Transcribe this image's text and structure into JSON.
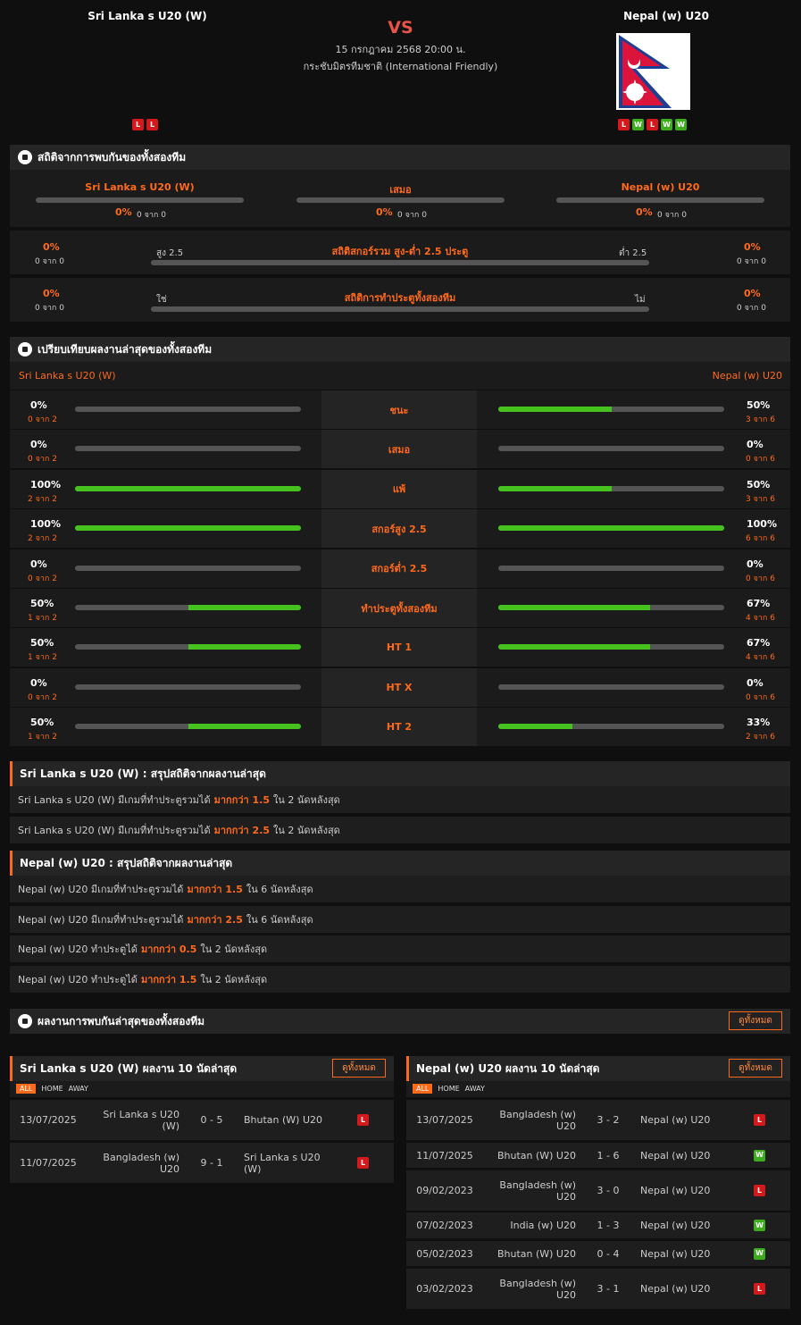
{
  "header": {
    "home_team": "Sri Lanka s U20 (W)",
    "away_team": "Nepal (w) U20",
    "vs": "VS",
    "date": "15 กรกฎาคม 2568 20:00 น.",
    "competition": "กระชับมิตรทีมชาติ (International Friendly)",
    "home_form": [
      "L",
      "L"
    ],
    "away_form": [
      "L",
      "W",
      "L",
      "W",
      "W"
    ],
    "colors": {
      "accent": "#ff6a1a",
      "win": "#3dac1f",
      "loss": "#d4181c",
      "bar_green": "#46c21e",
      "vs": "#e8544a"
    }
  },
  "h2h": {
    "title": "สถิติจากการพบกันของทั้งสองทีม",
    "cols": [
      {
        "label": "Sri Lanka s U20 (W)",
        "pct": "0%",
        "sub": "0 จาก 0"
      },
      {
        "label": "เสมอ",
        "pct": "0%",
        "sub": "0 จาก 0"
      },
      {
        "label": "Nepal (w) U20",
        "pct": "0%",
        "sub": "0 จาก 0"
      }
    ],
    "ou": {
      "title": "สถิติสกอร์รวม สูง-ต่ำ 2.5 ประตู",
      "left_label": "สูง 2.5",
      "right_label": "ต่ำ 2.5",
      "left_pct": "0%",
      "left_sub": "0 จาก 0",
      "right_pct": "0%",
      "right_sub": "0 จาก 0"
    },
    "btts": {
      "title": "สถิติการทำประตูทั้งสองทีม",
      "left_label": "ใช่",
      "right_label": "ไม่",
      "left_pct": "0%",
      "left_sub": "0 จาก 0",
      "right_pct": "0%",
      "right_sub": "0 จาก 0"
    }
  },
  "compare": {
    "title": "เปรียบเทียบผลงานล่าสุดของทั้งสองทีม",
    "home": "Sri Lanka s U20 (W)",
    "away": "Nepal (w) U20",
    "rows": [
      {
        "label": "ชนะ",
        "l_pct": "0%",
        "l_sub": "0 จาก 2",
        "l_val": 0,
        "r_pct": "50%",
        "r_sub": "3 จาก 6",
        "r_val": 0.5
      },
      {
        "label": "เสมอ",
        "l_pct": "0%",
        "l_sub": "0 จาก 2",
        "l_val": 0,
        "r_pct": "0%",
        "r_sub": "0 จาก 6",
        "r_val": 0
      },
      {
        "label": "แพ้",
        "l_pct": "100%",
        "l_sub": "2 จาก 2",
        "l_val": 1,
        "r_pct": "50%",
        "r_sub": "3 จาก 6",
        "r_val": 0.5
      },
      {
        "label": "สกอร์สูง 2.5",
        "l_pct": "100%",
        "l_sub": "2 จาก 2",
        "l_val": 1,
        "r_pct": "100%",
        "r_sub": "6 จาก 6",
        "r_val": 1
      },
      {
        "label": "สกอร์ต่ำ 2.5",
        "l_pct": "0%",
        "l_sub": "0 จาก 2",
        "l_val": 0,
        "r_pct": "0%",
        "r_sub": "0 จาก 6",
        "r_val": 0
      },
      {
        "label": "ทำประตูทั้งสองทีม",
        "l_pct": "50%",
        "l_sub": "1 จาก 2",
        "l_val": 0.5,
        "r_pct": "67%",
        "r_sub": "4 จาก 6",
        "r_val": 0.67
      },
      {
        "label": "HT 1",
        "l_pct": "50%",
        "l_sub": "1 จาก 2",
        "l_val": 0.5,
        "r_pct": "67%",
        "r_sub": "4 จาก 6",
        "r_val": 0.67
      },
      {
        "label": "HT X",
        "l_pct": "0%",
        "l_sub": "0 จาก 2",
        "l_val": 0,
        "r_pct": "0%",
        "r_sub": "0 จาก 6",
        "r_val": 0
      },
      {
        "label": "HT 2",
        "l_pct": "50%",
        "l_sub": "1 จาก 2",
        "l_val": 0.5,
        "r_pct": "33%",
        "r_sub": "2 จาก 6",
        "r_val": 0.33
      }
    ]
  },
  "summary_home": {
    "title": "Sri Lanka s U20 (W) : สรุปสถิติจากผลงานล่าสุด",
    "rows": [
      {
        "pre": "Sri Lanka s U20 (W)  มีเกมที่ทำประตูรวมได้",
        "hl": "มากกว่า  1.5",
        "post": "ใน 2 นัดหลังสุด"
      },
      {
        "pre": "Sri Lanka s U20 (W)  มีเกมที่ทำประตูรวมได้",
        "hl": "มากกว่า  2.5",
        "post": "ใน 2 นัดหลังสุด"
      }
    ]
  },
  "summary_away": {
    "title": "Nepal (w) U20 : สรุปสถิติจากผลงานล่าสุด",
    "rows": [
      {
        "pre": "Nepal (w) U20  มีเกมที่ทำประตูรวมได้",
        "hl": "มากกว่า  1.5",
        "post": "ใน 6 นัดหลังสุด"
      },
      {
        "pre": "Nepal (w) U20  มีเกมที่ทำประตูรวมได้",
        "hl": "มากกว่า  2.5",
        "post": "ใน 6 นัดหลังสุด"
      },
      {
        "pre": "Nepal (w) U20  ทำประตูได้",
        "hl": "มากกว่า  0.5",
        "post": "ใน 2 นัดหลังสุด"
      },
      {
        "pre": "Nepal (w) U20  ทำประตูได้",
        "hl": "มากกว่า  1.5",
        "post": "ใน 2 นัดหลังสุด"
      }
    ]
  },
  "recent": {
    "title": "ผลงานการพบกันล่าสุดของทั้งสองทีม",
    "view_all": "ดูทั้งหมด",
    "filters": [
      "ALL",
      "HOME",
      "AWAY"
    ],
    "home": {
      "title": "Sri Lanka s U20 (W) ผลงาน 10 นัดล่าสุด",
      "matches": [
        {
          "date": "13/07/2025",
          "home": "Sri Lanka s U20 (W)",
          "score": "0 - 5",
          "away": "Bhutan (W) U20",
          "res": "L"
        },
        {
          "date": "11/07/2025",
          "home": "Bangladesh (w) U20",
          "score": "9 - 1",
          "away": "Sri Lanka s U20 (W)",
          "res": "L"
        }
      ]
    },
    "away": {
      "title": "Nepal (w) U20 ผลงาน 10 นัดล่าสุด",
      "matches": [
        {
          "date": "13/07/2025",
          "home": "Bangladesh (w) U20",
          "score": "3 - 2",
          "away": "Nepal (w) U20",
          "res": "L"
        },
        {
          "date": "11/07/2025",
          "home": "Bhutan (W) U20",
          "score": "1 - 6",
          "away": "Nepal (w) U20",
          "res": "W"
        },
        {
          "date": "09/02/2023",
          "home": "Bangladesh (w) U20",
          "score": "3 - 0",
          "away": "Nepal (w) U20",
          "res": "L"
        },
        {
          "date": "07/02/2023",
          "home": "India (w) U20",
          "score": "1 - 3",
          "away": "Nepal (w) U20",
          "res": "W"
        },
        {
          "date": "05/02/2023",
          "home": "Bhutan (W) U20",
          "score": "0 - 4",
          "away": "Nepal (w) U20",
          "res": "W"
        },
        {
          "date": "03/02/2023",
          "home": "Bangladesh (w) U20",
          "score": "3 - 1",
          "away": "Nepal (w) U20",
          "res": "L"
        }
      ]
    }
  }
}
